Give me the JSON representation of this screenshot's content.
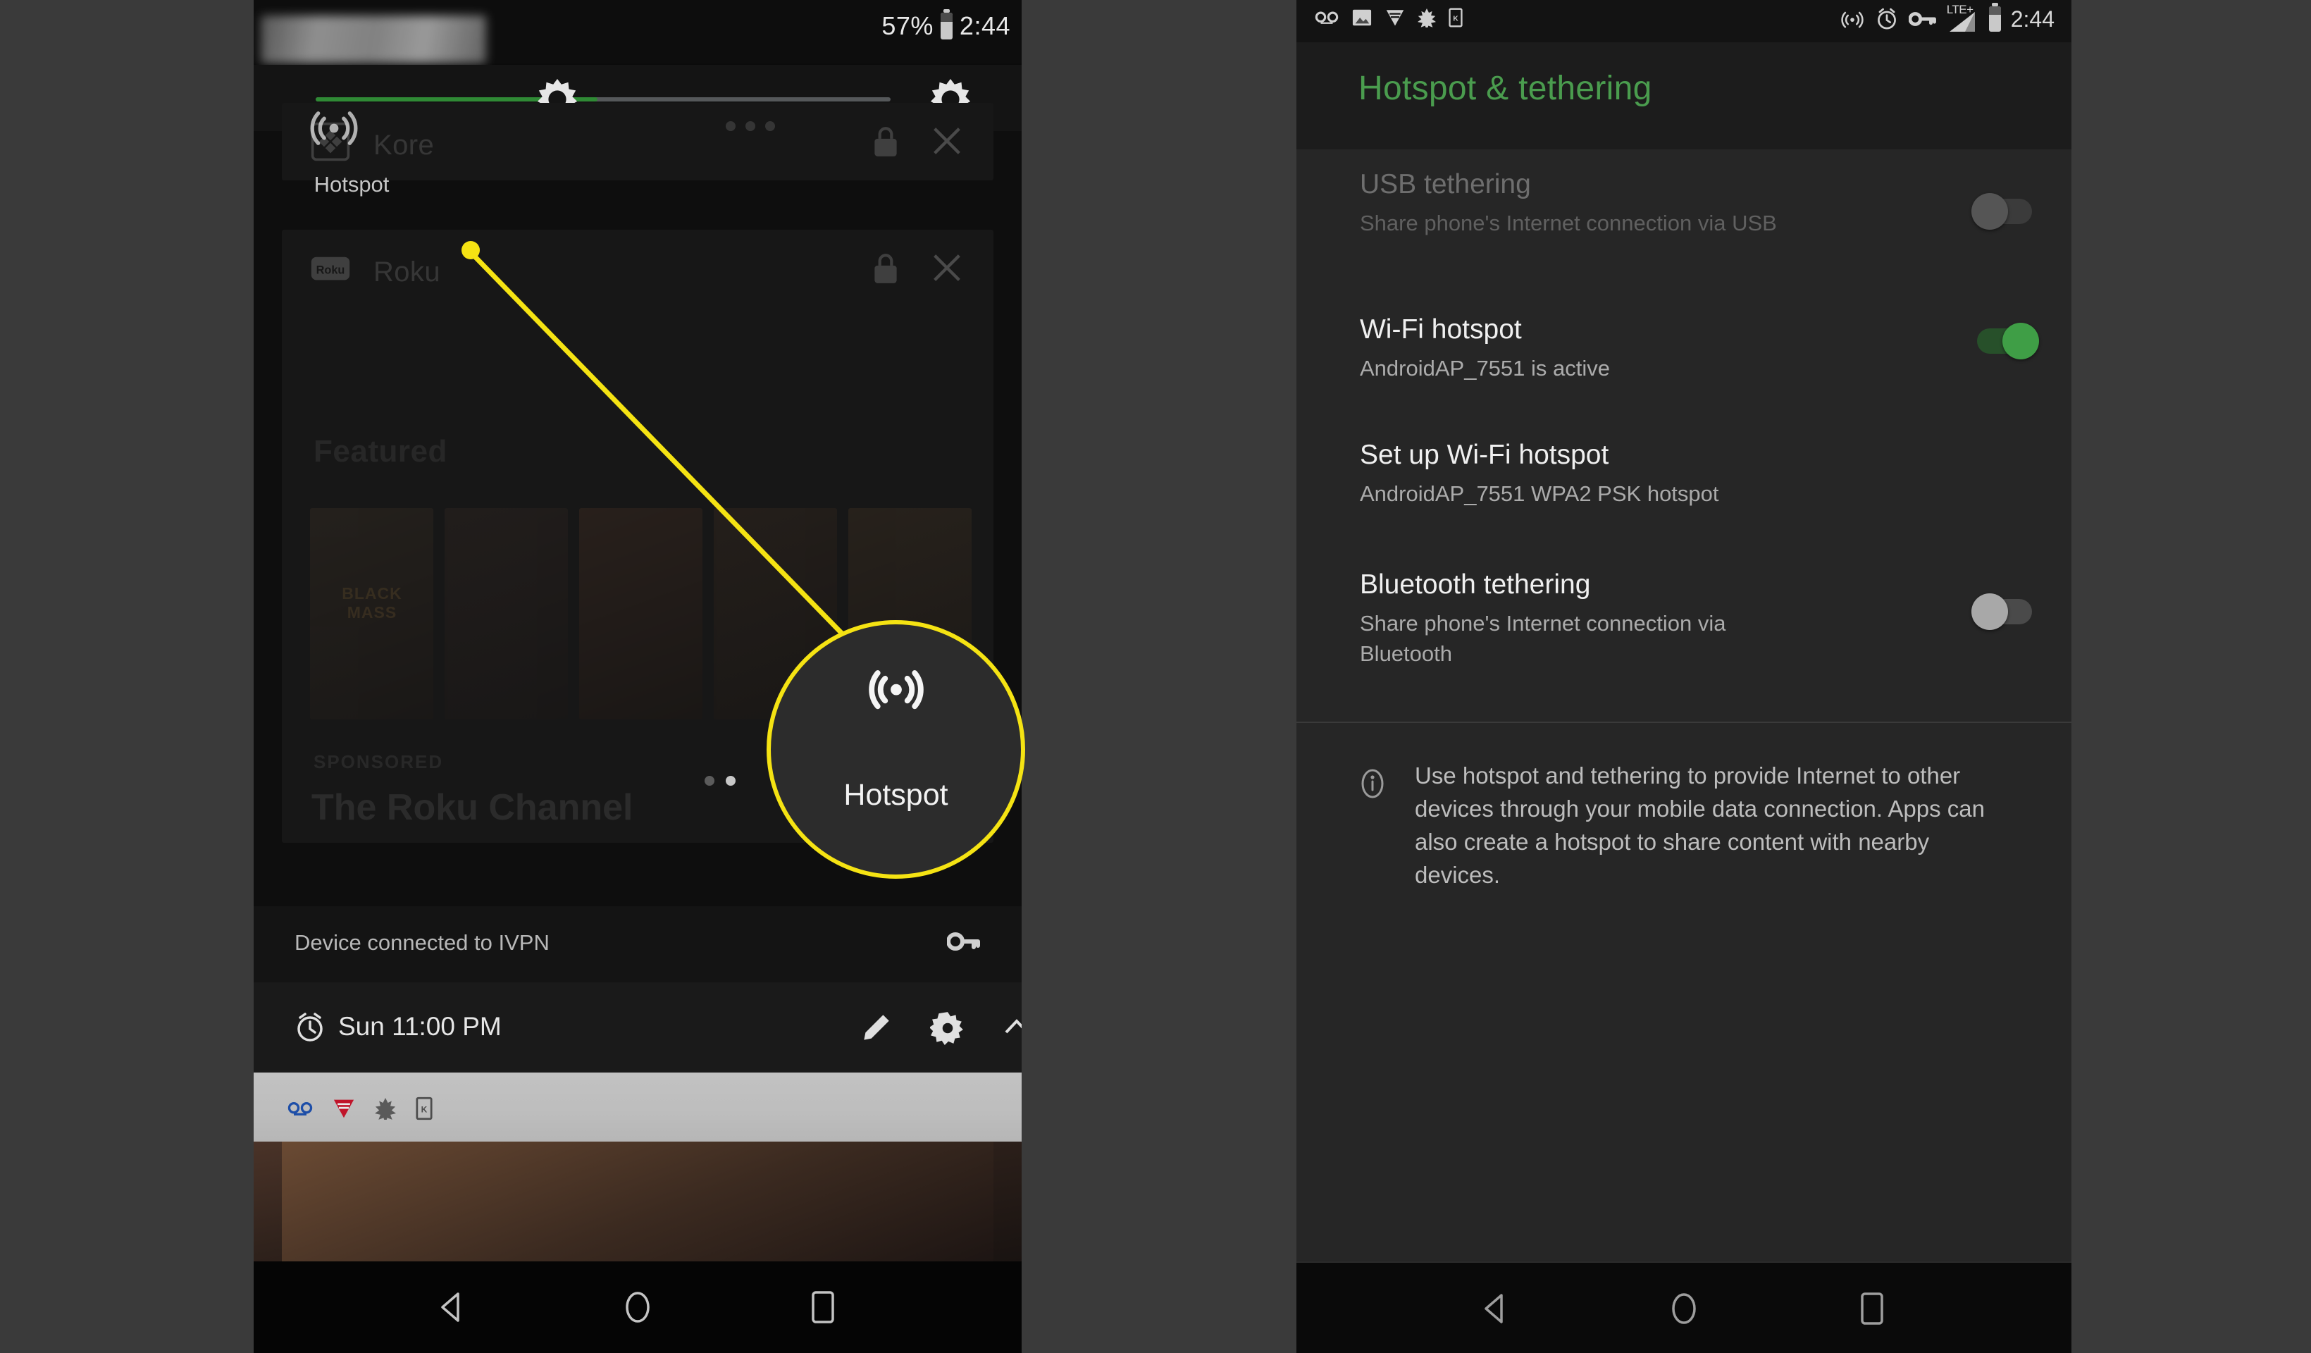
{
  "left_phone": {
    "statusbar": {
      "battery_percent": "57%",
      "time": "2:44",
      "battery_icon": "battery-icon"
    },
    "brightness": {
      "label": "brightness-slider",
      "fill_percent": 49,
      "thumb_icon": "brightness-sun-icon",
      "auto_icon": "brightness-auto-icon"
    },
    "quick_settings": {
      "hotspot_tile_label": "Hotspot",
      "hotspot_icon": "hotspot-icon",
      "page_dots": 3
    },
    "notifications": [
      {
        "app": "Kore",
        "app_icon": "kore-icon",
        "lock_icon": "lock-icon",
        "close_icon": "close-icon"
      },
      {
        "app": "Roku",
        "app_icon": "roku-icon",
        "lock_icon": "lock-icon",
        "close_icon": "close-icon"
      }
    ],
    "roku_content": {
      "featured_label": "Featured",
      "sponsored_label": "SPONSORED",
      "channel_title": "The Roku Channel",
      "posters": [
        {
          "title": "BLACK MASS",
          "c1": "#4a3b2c",
          "c2": "#241c16"
        },
        {
          "title": "",
          "c1": "#3f2f28",
          "c2": "#1e1715"
        },
        {
          "title": "",
          "c1": "#5a3a2a",
          "c2": "#241811"
        },
        {
          "title": "",
          "c1": "#4a3424",
          "c2": "#1f1711"
        },
        {
          "title": "",
          "c1": "#56402a",
          "c2": "#241a12"
        }
      ],
      "overflow_label": "..."
    },
    "vpn_row": {
      "text": "Device connected to IVPN",
      "icon": "key-icon"
    },
    "alarm_row": {
      "text": "Sun 11:00 PM",
      "clock_icon": "alarm-clock-icon",
      "edit_icon": "pencil-icon",
      "settings_icon": "gear-icon",
      "collapse_icon": "chevron-up-icon"
    },
    "tray_icons": [
      "voicemail-icon",
      "v-logo-icon",
      "leaf-icon",
      "kindle-icon"
    ],
    "navbar": {
      "back": "back-triangle-icon",
      "home": "home-circle-icon",
      "recents": "recents-square-icon"
    }
  },
  "callout": {
    "color": "#f5e313",
    "magnifier_label": "Hotspot",
    "magnifier_icon": "hotspot-icon"
  },
  "right_phone": {
    "statusbar": {
      "left_icons": [
        "voicemail-icon",
        "photo-icon",
        "v-logo-icon",
        "leaf-icon",
        "kindle-icon"
      ],
      "right_icons": [
        "hotspot-icon",
        "alarm-clock-icon",
        "key-icon",
        "lte-signal-icon",
        "battery-icon"
      ],
      "network_label": "LTE+",
      "time": "2:44"
    },
    "header": {
      "title": "Hotspot & tethering",
      "title_color": "#4a9c4e"
    },
    "rows": [
      {
        "title": "USB tethering",
        "summary": "Share phone's Internet connection via USB",
        "control": "toggle",
        "state": "off",
        "disabled": true,
        "thumb_color": "#555555",
        "track_color": "#3b3b3b"
      },
      {
        "title": "Wi-Fi hotspot",
        "summary": "AndroidAP_7551 is active",
        "control": "toggle",
        "state": "on",
        "disabled": false,
        "thumb_color": "#3f9e46",
        "track_color": "#27502a"
      },
      {
        "title": "Set up Wi-Fi hotspot",
        "summary": "AndroidAP_7551 WPA2 PSK hotspot",
        "control": "none",
        "state": "",
        "disabled": false,
        "thumb_color": "",
        "track_color": ""
      },
      {
        "title": "Bluetooth tethering",
        "summary": "Share phone's Internet connection via Bluetooth",
        "control": "toggle",
        "state": "off",
        "disabled": false,
        "thumb_color": "#a8a8a8",
        "track_color": "#4a4a4a"
      }
    ],
    "info": {
      "icon": "info-icon",
      "text": "Use hotspot and tethering to provide Internet to other devices through your mobile data connection. Apps can also create a hotspot to share content with nearby devices."
    },
    "navbar": {
      "back": "back-triangle-icon",
      "home": "home-circle-icon",
      "recents": "recents-square-icon"
    }
  }
}
